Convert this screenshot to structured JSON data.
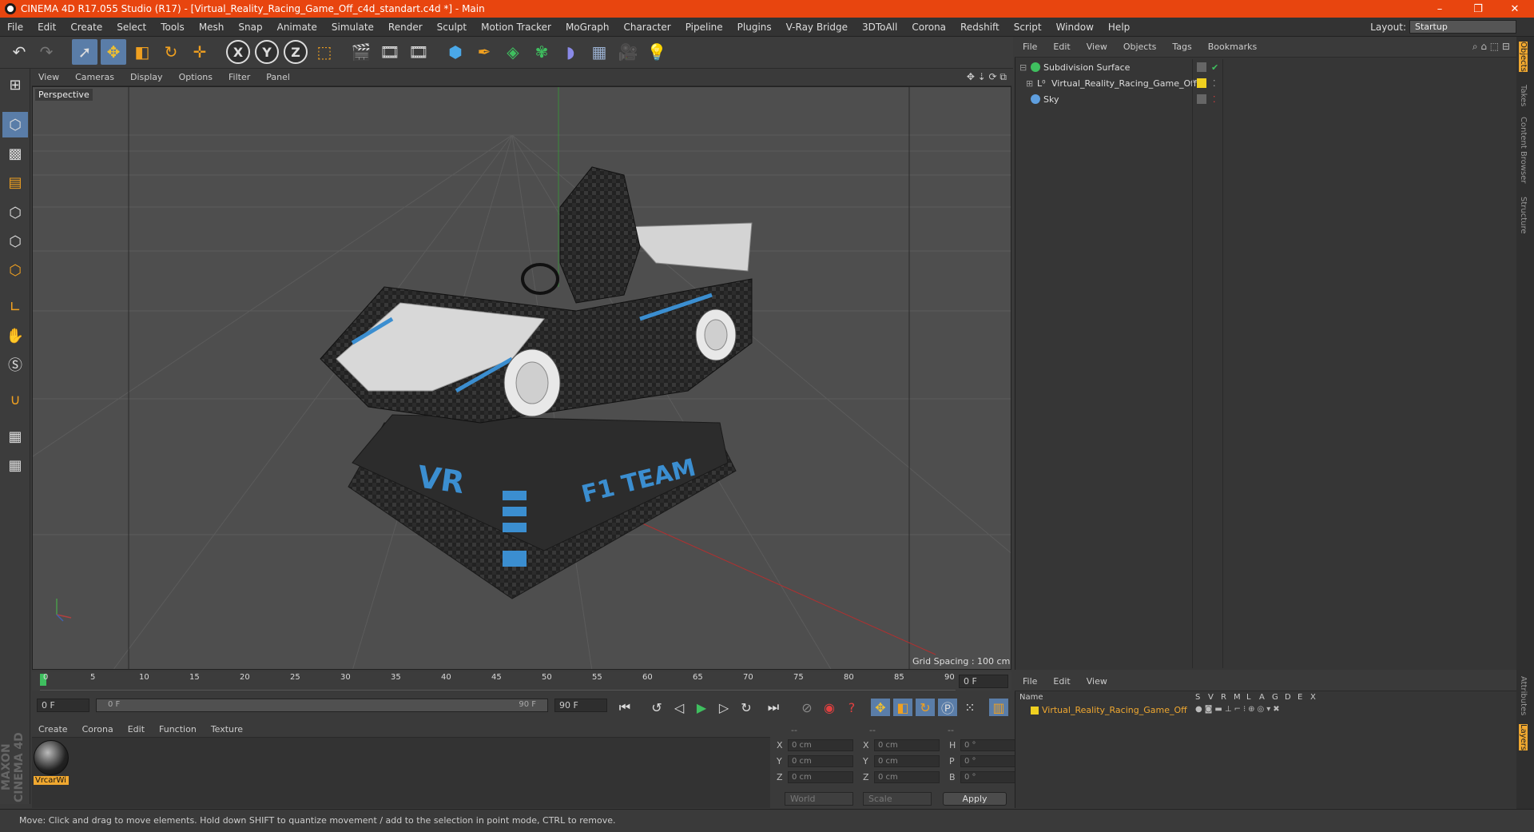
{
  "window": {
    "title": "CINEMA 4D R17.055 Studio (R17) - [Virtual_Reality_Racing_Game_Off_c4d_standart.c4d *] - Main",
    "minimize": "–",
    "restore": "❐",
    "close": "✕"
  },
  "menubar": {
    "items": [
      "File",
      "Edit",
      "Create",
      "Select",
      "Tools",
      "Mesh",
      "Snap",
      "Animate",
      "Simulate",
      "Render",
      "Sculpt",
      "Motion Tracker",
      "MoGraph",
      "Character",
      "Pipeline",
      "Plugins",
      "V-Ray Bridge",
      "3DToAll",
      "Corona",
      "Redshift",
      "Script",
      "Window",
      "Help"
    ],
    "layout_label": "Layout:",
    "layout_value": "Startup"
  },
  "viewport": {
    "menu": [
      "View",
      "Cameras",
      "Display",
      "Options",
      "Filter",
      "Panel"
    ],
    "camera_label": "Perspective",
    "grid_spacing": "Grid Spacing : 100 cm",
    "model_text_vr": "VR",
    "model_text_team": "F1 TEAM"
  },
  "timeline": {
    "ticks": [
      "0",
      "5",
      "10",
      "15",
      "20",
      "25",
      "30",
      "35",
      "40",
      "45",
      "50",
      "55",
      "60",
      "65",
      "70",
      "75",
      "80",
      "85",
      "90"
    ],
    "current_frame": "0 F",
    "start_field": "0 F",
    "range_start": "0 F",
    "range_end": "90 F",
    "end_field": "90 F"
  },
  "material_manager": {
    "menu": [
      "Create",
      "Corona",
      "Edit",
      "Function",
      "Texture"
    ],
    "material_name": "VrcarWi"
  },
  "coordinates": {
    "header": [
      "--",
      "--",
      "--"
    ],
    "rows": [
      {
        "a": "X",
        "av": "0 cm",
        "b": "X",
        "bv": "0 cm",
        "c": "H",
        "cv": "0 °"
      },
      {
        "a": "Y",
        "av": "0 cm",
        "b": "Y",
        "bv": "0 cm",
        "c": "P",
        "cv": "0 °"
      },
      {
        "a": "Z",
        "av": "0 cm",
        "b": "Z",
        "bv": "0 cm",
        "c": "B",
        "cv": "0 °"
      }
    ],
    "world": "World",
    "scale": "Scale",
    "apply": "Apply"
  },
  "object_manager": {
    "menu": [
      "File",
      "Edit",
      "View",
      "Objects",
      "Tags",
      "Bookmarks"
    ],
    "objects": [
      {
        "name": "Subdivision Surface",
        "color": "#3fbf5f"
      },
      {
        "name": "Virtual_Reality_Racing_Game_Off",
        "color": "#e0e0e0"
      },
      {
        "name": "Sky",
        "color": "#5f9fdf"
      }
    ]
  },
  "layer_manager": {
    "menu": [
      "File",
      "Edit",
      "View"
    ],
    "columns": [
      "Name",
      "S",
      "V",
      "R",
      "M",
      "L",
      "A",
      "G",
      "D",
      "E",
      "X"
    ],
    "layer_name": "Virtual_Reality_Racing_Game_Off"
  },
  "right_tabs": [
    "Objects",
    "Takes",
    "Content Browser",
    "Structure",
    "Attributes",
    "Layers"
  ],
  "status": "Move: Click and drag to move elements. Hold down SHIFT to quantize movement / add to the selection in point mode, CTRL to remove.",
  "logo": "MAXON CINEMA 4D",
  "colors": {
    "accent": "#e8450f",
    "active": "#5a7da8",
    "layer_color": "#f0d020"
  }
}
